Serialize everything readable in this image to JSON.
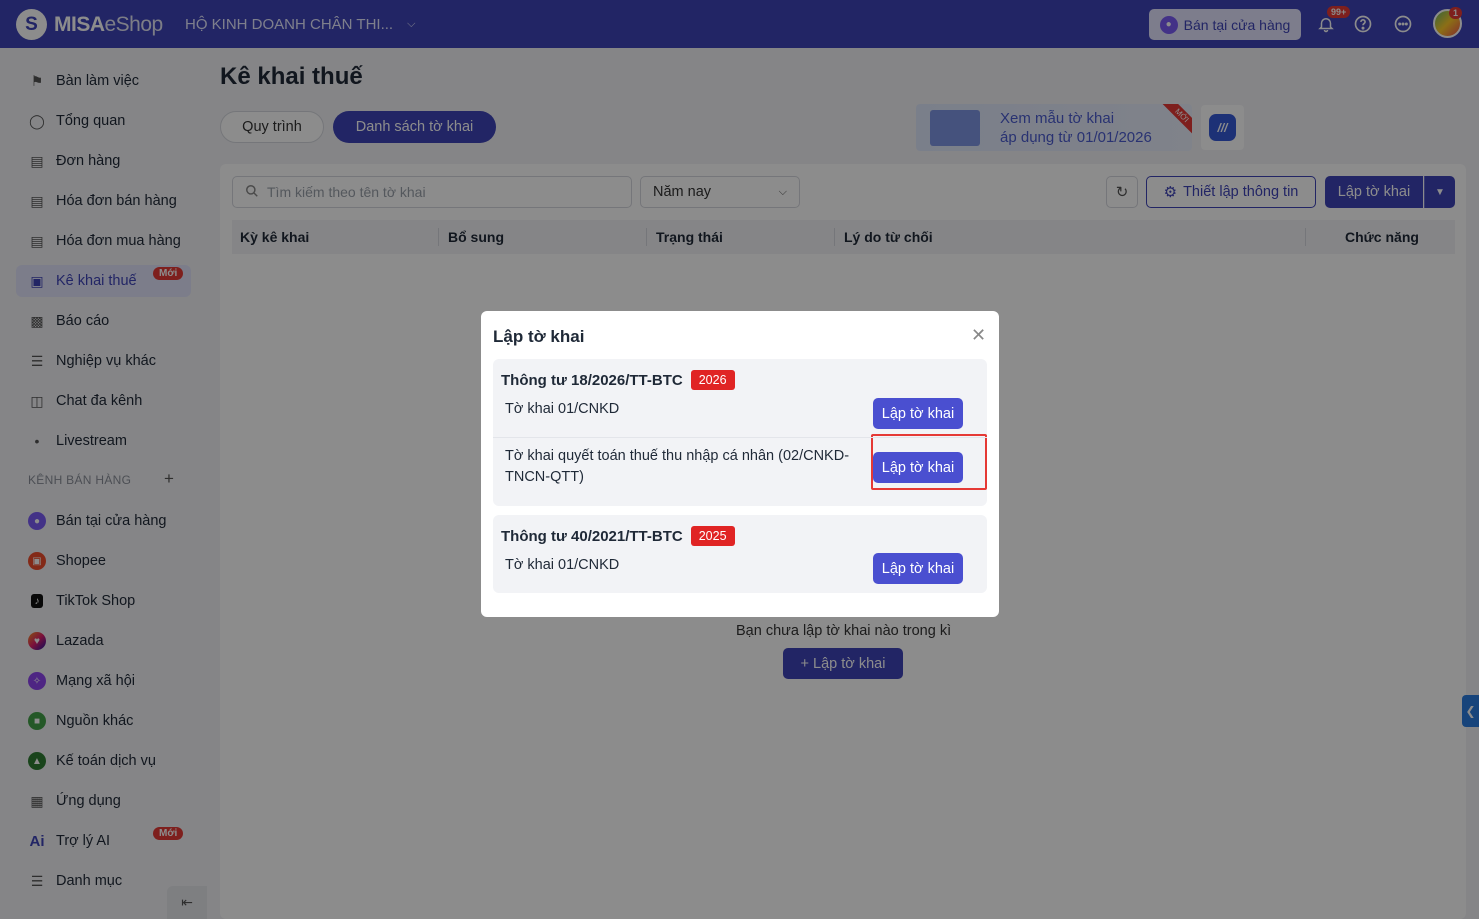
{
  "topbar": {
    "logo_mark": "S",
    "logo_bold": "MISA",
    "logo_light": "eShop",
    "store_name": "HỘ KINH DOANH CHÂN THI...",
    "sell_button": "Bán tại cửa hàng",
    "notifications_badge": "99+",
    "avatar_badge": "1"
  },
  "sidebar": {
    "items": [
      {
        "label": "Bàn làm việc",
        "icon": "flag-icon"
      },
      {
        "label": "Tổng quan",
        "icon": "dashboard-icon"
      },
      {
        "label": "Đơn hàng",
        "icon": "order-icon"
      },
      {
        "label": "Hóa đơn bán hàng",
        "icon": "invoice-icon"
      },
      {
        "label": "Hóa đơn mua hàng",
        "icon": "purchase-invoice-icon"
      },
      {
        "label": "Kê khai thuế",
        "icon": "tax-icon",
        "badge": "Mới"
      },
      {
        "label": "Báo cáo",
        "icon": "report-icon"
      },
      {
        "label": "Nghiệp vụ khác",
        "icon": "list-icon"
      },
      {
        "label": "Chat đa kênh",
        "icon": "chat-icon"
      },
      {
        "label": "Livestream",
        "icon": "livestream-icon"
      }
    ],
    "section_title": "KÊNH BÁN HÀNG",
    "channels": [
      {
        "label": "Bán tại cửa hàng",
        "color": "#7b5cf6"
      },
      {
        "label": "Shopee",
        "color": "#ee4d2d"
      },
      {
        "label": "TikTok Shop",
        "color": "#111111"
      },
      {
        "label": "Lazada",
        "color": "#1a1aa6"
      },
      {
        "label": "Mạng xã hội",
        "color": "#8e44ef"
      },
      {
        "label": "Nguồn khác",
        "color": "#43a047"
      },
      {
        "label": "Kế toán dịch vụ",
        "color": "#2e7d32"
      }
    ],
    "extra": [
      {
        "label": "Ứng dụng",
        "icon": "apps-icon"
      },
      {
        "label": "Trợ lý AI",
        "icon": "ai-icon",
        "badge": "Mới"
      },
      {
        "label": "Danh mục",
        "icon": "menu-icon"
      }
    ]
  },
  "main": {
    "title": "Kê khai thuế",
    "tabs": [
      "Quy trình",
      "Danh sách tờ khai"
    ],
    "promo": {
      "line1": "Xem mẫu tờ khai",
      "line2": "áp dụng từ 01/01/2026",
      "ribbon": "MỚI"
    },
    "search_placeholder": "Tìm kiếm theo tên tờ khai",
    "year_filter": "Năm nay",
    "setup_button": "Thiết lập thông tin",
    "create_button": "Lập tờ khai",
    "columns": [
      "Kỳ kê khai",
      "Bổ sung",
      "Trạng thái",
      "Lý do từ chối",
      "Chức năng"
    ],
    "empty_text": "Bạn chưa lập tờ khai nào trong kì",
    "empty_button": "+ Lập tờ khai"
  },
  "modal": {
    "title": "Lập tờ khai",
    "groups": [
      {
        "title": "Thông tư 18/2026/TT-BTC",
        "year": "2026",
        "forms": [
          {
            "name": "Tờ khai 01/CNKD",
            "button": "Lập tờ khai"
          },
          {
            "name": "Tờ khai quyết toán thuế thu nhập cá nhân (02/CNKD-TNCN-QTT)",
            "button": "Lập tờ khai"
          }
        ]
      },
      {
        "title": "Thông tư 40/2021/TT-BTC",
        "year": "2025",
        "forms": [
          {
            "name": "Tờ khai 01/CNKD",
            "button": "Lập tờ khai"
          }
        ]
      }
    ]
  }
}
